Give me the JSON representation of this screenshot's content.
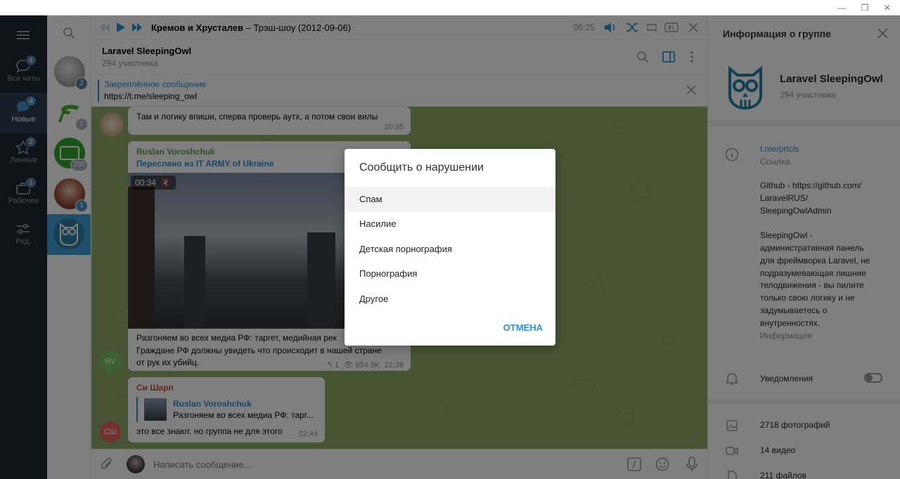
{
  "window": {
    "minimize": "—",
    "restore": "❐",
    "close": "✕"
  },
  "nav": {
    "items": [
      {
        "label": "Все чаты",
        "badge": "4"
      },
      {
        "label": "Новые",
        "badge": "4"
      },
      {
        "label": "Личные",
        "badge": "2"
      },
      {
        "label": "Рабочее",
        "badge": "1"
      },
      {
        "label": "Ред.",
        "badge": ""
      }
    ]
  },
  "chatlist": {
    "badges": [
      "2",
      "1",
      "250",
      "1"
    ]
  },
  "player": {
    "track_artist": "Кремов и Хрусталев",
    "track_title": " – Трэш-шоу (2012-09-06)",
    "time": "05:25"
  },
  "header": {
    "title": "Laravel SleepingOwl",
    "subtitle": "294 участника"
  },
  "pinned": {
    "label": "Закреплённое сообщение",
    "text": "https://t.me/sleeping_owl"
  },
  "messages": {
    "m1": {
      "text": "Там и логику впиши, сперва проверь аутх, а потом свои вилы",
      "time": "20:35"
    },
    "m2": {
      "author": "Ruslan Voroshchuk",
      "forwarded": "Переслано из IT ARMY of Ukraine",
      "video_time": "00:34",
      "text_lines": [
        "Разгоняем во всех медиа РФ: таргет, медийная рек",
        "Граждане РФ должны увидеть что происходит в нашей стране",
        "от рук их убийц."
      ],
      "replies": "1",
      "views": "654.9K",
      "time": "22:38",
      "avatar": "RV"
    },
    "m3": {
      "author": "Си Шарп",
      "reply_author": "Ruslan Voroshchuk",
      "reply_text": "Разгоняем во всех медиа РФ: тарг...",
      "text": "это все знают. но группа не для этого",
      "time": "22:44",
      "avatar": "СШ"
    }
  },
  "compose": {
    "placeholder": "Написать сообщение..."
  },
  "info": {
    "title": "Информация о группе",
    "group_name": "Laravel SleepingOwl",
    "members": "294 участника",
    "link": "t.me/prtcls",
    "link_label": "Ссылка",
    "desc_lines": [
      "Github - https://github.com/",
      "LaravelRUS/",
      "SleepingOwlAdmin",
      "",
      "SleepingOwl -",
      "административная панель",
      "для фреймворка Laravel, не",
      "подразумевающая лишние",
      "телодвижения - вы пилите",
      "только свою логику и не",
      "задумываетесь о",
      "внутренностях."
    ],
    "desc_label": "Информация",
    "notifications": "Уведомления",
    "media": [
      {
        "label": "2718 фотографий",
        "icon": "photo-icon"
      },
      {
        "label": "14 видео",
        "icon": "video-icon"
      },
      {
        "label": "211 файлов",
        "icon": "file-icon"
      }
    ]
  },
  "dialog": {
    "title": "Сообщить о нарушении",
    "options": [
      "Спам",
      "Насилие",
      "Детская порнография",
      "Порнография",
      "Другое"
    ],
    "cancel": "ОТМЕНА"
  },
  "colors": {
    "accent": "#2b8fd5",
    "nav_bg": "#1c2733",
    "chat_bg": "#8fab6b"
  }
}
